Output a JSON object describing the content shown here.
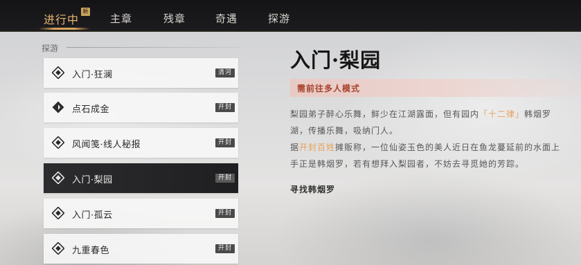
{
  "nav": {
    "tabs": [
      {
        "label": "进行中",
        "active": true,
        "badge": "新"
      },
      {
        "label": "主章",
        "active": false
      },
      {
        "label": "残章",
        "active": false
      },
      {
        "label": "奇遇",
        "active": false
      },
      {
        "label": "探游",
        "active": false
      }
    ]
  },
  "list": {
    "section_label": "探游",
    "quests": [
      {
        "name": "入门·狂澜",
        "location": "清河",
        "selected": false
      },
      {
        "name": "点石成金",
        "location": "开封",
        "selected": false
      },
      {
        "name": "风闻笺·线人秘报",
        "location": "开封",
        "selected": false
      },
      {
        "name": "入门·梨园",
        "location": "开封",
        "selected": true
      },
      {
        "name": "入门·孤云",
        "location": "开封",
        "selected": false
      },
      {
        "name": "九重春色",
        "location": "开封",
        "selected": false
      }
    ]
  },
  "detail": {
    "title": "入门·梨园",
    "requirement": "需前往多人模式",
    "line1_a": "梨园弟子醉心乐舞，鲜少在江湖露面，但有园内",
    "line1_hl": "「十二律」",
    "line1_b": "韩烟罗",
    "line2": "湖，传播乐舞，吸纳门人。",
    "line3_a": "据",
    "line3_hl": "开封百姓",
    "line3_b": "摊贩称，一位仙姿玉色的美人近日在鱼龙蔓延前的水面上",
    "line4": "手正是韩烟罗，若有想拜入梨园者，不妨去寻觅她的芳踪。",
    "objective": "寻找韩烟罗"
  },
  "colors": {
    "accent_gold": "#e7b673",
    "requirement_red": "#a5432d",
    "highlight_orange": "#e4a05c",
    "topbar_bg": "#141416"
  }
}
